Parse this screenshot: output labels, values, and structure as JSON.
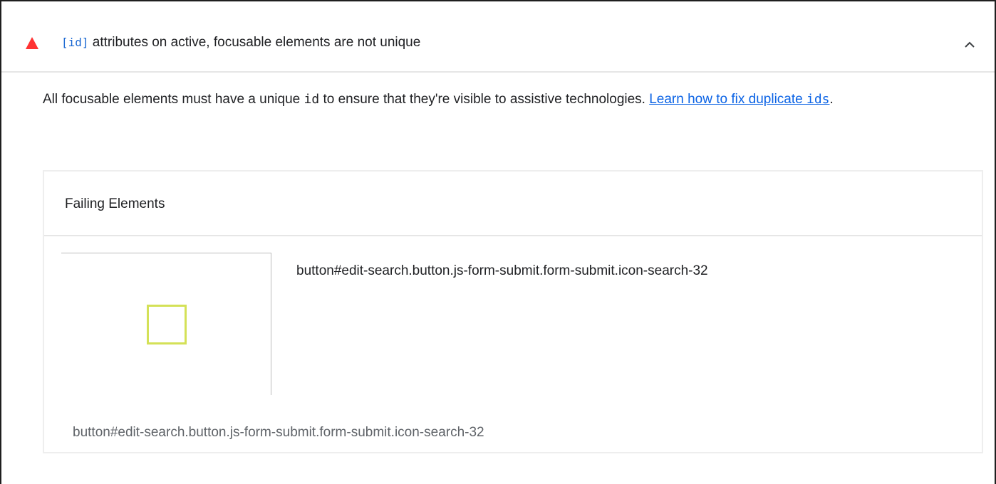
{
  "audit": {
    "title_code": "[id]",
    "title_text": " attributes on active, focusable elements are not unique",
    "status_color": "#ff3333",
    "status_icon": "fail-triangle-icon",
    "toggle_icon": "chevron-up-icon"
  },
  "description": {
    "part1": "All focusable elements must have a unique ",
    "code": "id",
    "part2": " to ensure that they're visible to assistive technologies. ",
    "link_text": "Learn how to fix duplicate ",
    "link_code": "ids",
    "end": "."
  },
  "details": {
    "header": "Failing Elements",
    "rows": [
      {
        "selector": "button#edit-search.button.js-form-submit.form-submit.icon-search-32",
        "path": "button#edit-search.button.js-form-submit.form-submit.icon-search-32",
        "highlight_color": "#d4e157"
      }
    ]
  }
}
